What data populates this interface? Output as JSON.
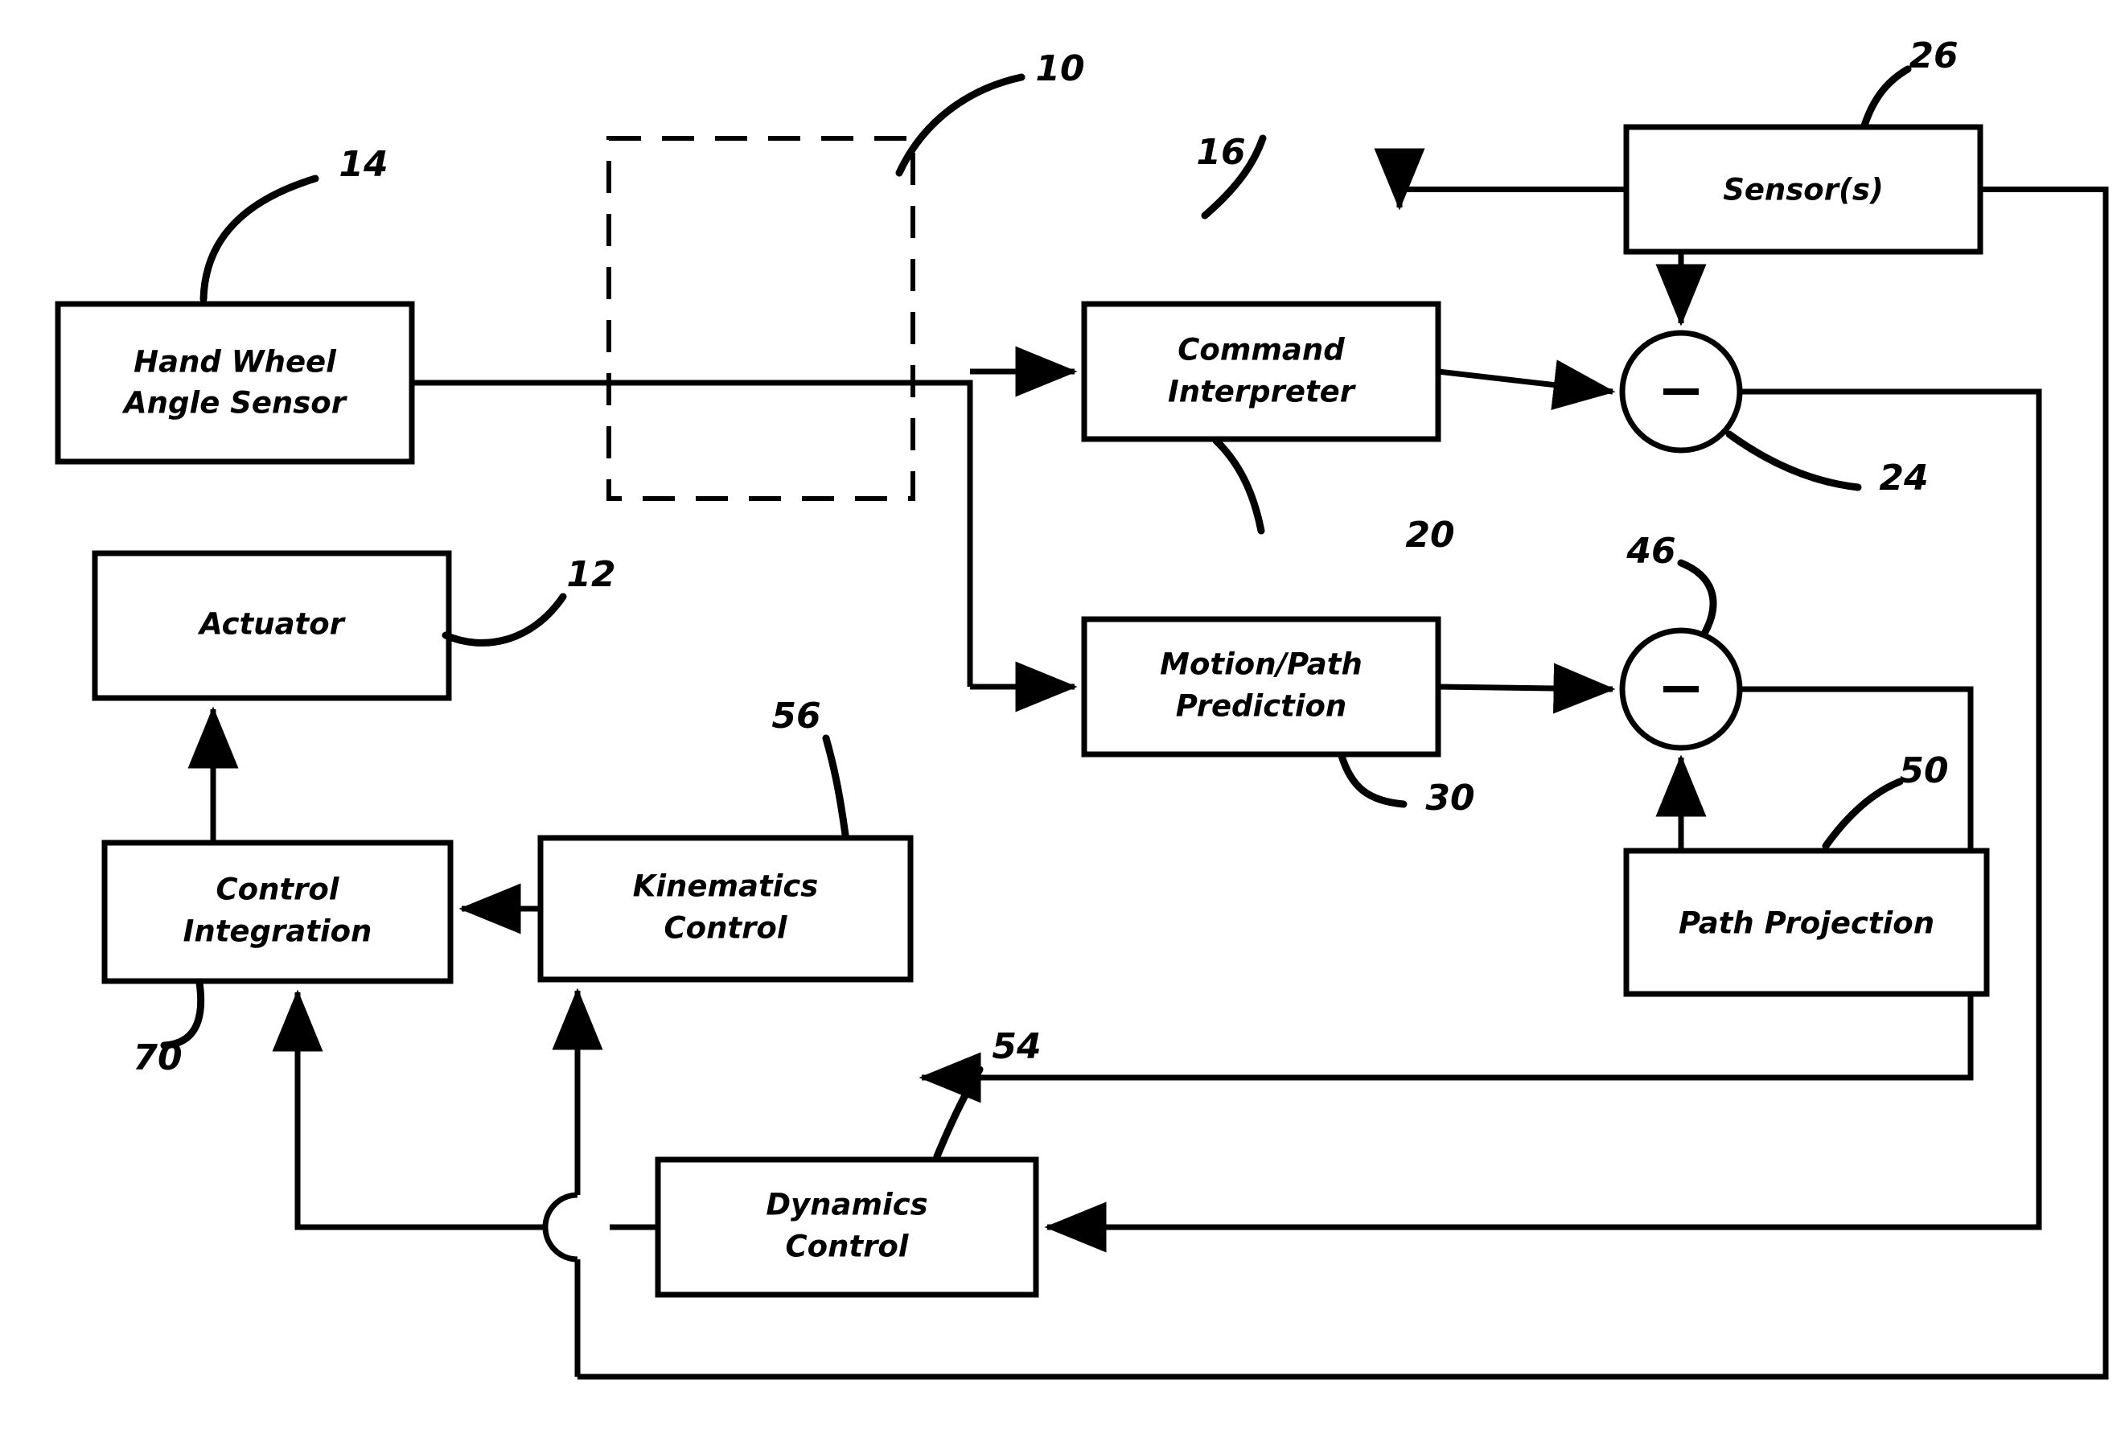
{
  "figure": {
    "type": "patent-block-diagram",
    "reference_numeral": "10",
    "background_color": "#ffffff",
    "line_color": "#000000"
  },
  "blocks": [
    {
      "id": "hand-wheel-angle-sensor",
      "line1": "Hand Wheel",
      "line2": "Angle Sensor",
      "ref": "14"
    },
    {
      "id": "actuator",
      "line1": "Actuator",
      "line2": "",
      "ref": "12"
    },
    {
      "id": "control-integration",
      "line1": "Control",
      "line2": "Integration",
      "ref": "70"
    },
    {
      "id": "kinematics-control",
      "line1": "Kinematics",
      "line2": "Control",
      "ref": "56"
    },
    {
      "id": "dynamics-control",
      "line1": "Dynamics",
      "line2": "Control",
      "ref": "54"
    },
    {
      "id": "command-interpreter",
      "line1": "Command",
      "line2": "Interpreter",
      "ref": "20"
    },
    {
      "id": "motion-path-prediction",
      "line1": "Motion/Path",
      "line2": "Prediction",
      "ref": "30"
    },
    {
      "id": "sensors",
      "line1": "Sensor(s)",
      "line2": "",
      "ref": "26"
    },
    {
      "id": "path-projection",
      "line1": "Path Projection",
      "line2": "",
      "ref": "50"
    }
  ],
  "summing_junctions": [
    {
      "id": "summing-junction-24",
      "sign": "–",
      "ref": "24"
    },
    {
      "id": "summing-junction-46",
      "sign": "–",
      "ref": "46"
    }
  ],
  "dashed_group": {
    "id": "controller-group",
    "ref": "16"
  },
  "reference_numerals": {
    "figure": "10",
    "actuator": "12",
    "hand_wheel_angle_sensor": "14",
    "controller_group": "16",
    "command_interpreter": "20",
    "summing_junction_upper": "24",
    "sensors": "26",
    "motion_path_prediction": "30",
    "summing_junction_lower": "46",
    "path_projection": "50",
    "dynamics_control": "54",
    "kinematics_control": "56",
    "control_integration": "70"
  },
  "labels": {
    "hand_wheel_l1": "Hand Wheel",
    "hand_wheel_l2": "Angle Sensor",
    "actuator": "Actuator",
    "control_integration_l1": "Control",
    "control_integration_l2": "Integration",
    "kinematics_l1": "Kinematics",
    "kinematics_l2": "Control",
    "dynamics_l1": "Dynamics",
    "dynamics_l2": "Control",
    "command_interpreter_l1": "Command",
    "command_interpreter_l2": "Interpreter",
    "motion_path_l1": "Motion/Path",
    "motion_path_l2": "Prediction",
    "sensors": "Sensor(s)",
    "path_projection": "Path Projection",
    "minus": "–"
  }
}
